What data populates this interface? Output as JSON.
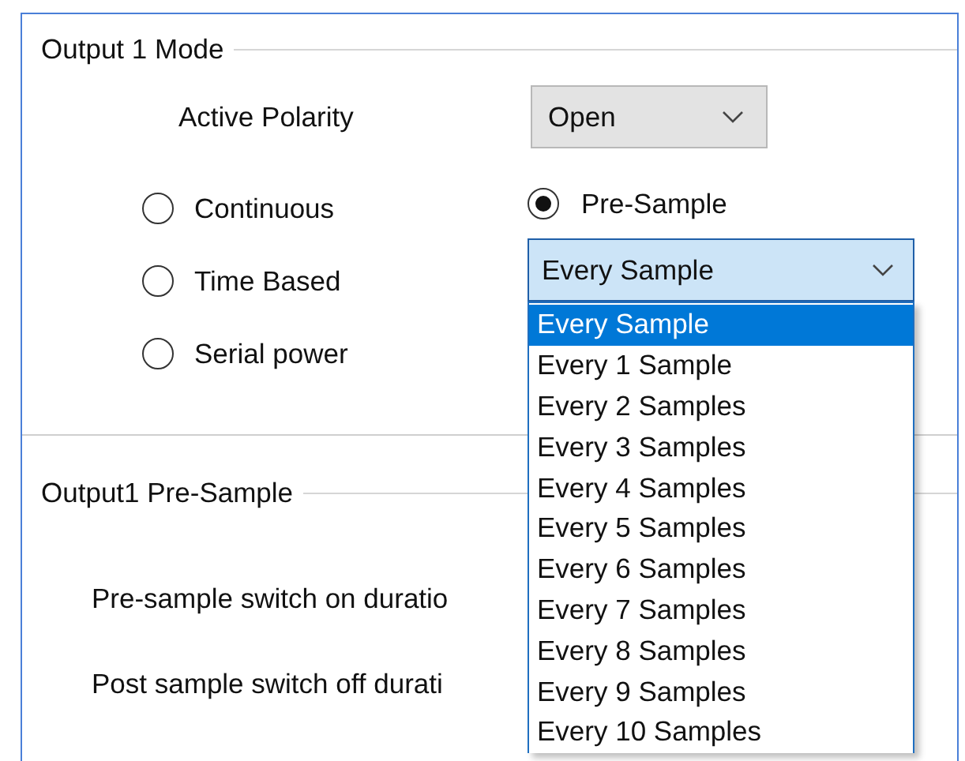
{
  "output_mode": {
    "title": "Output 1 Mode",
    "active_polarity": {
      "label": "Active Polarity",
      "value": "Open"
    },
    "modes": [
      {
        "label": "Continuous",
        "selected": false
      },
      {
        "label": "Time Based",
        "selected": false
      },
      {
        "label": "Serial power",
        "selected": false
      }
    ],
    "pre_sample": {
      "label": "Pre-Sample",
      "selected": true,
      "value": "Every Sample",
      "expanded": true,
      "options": [
        {
          "label": "Every Sample",
          "selected": true
        },
        {
          "label": "Every 1 Sample",
          "selected": false
        },
        {
          "label": "Every 2 Samples",
          "selected": false
        },
        {
          "label": "Every 3 Samples",
          "selected": false
        },
        {
          "label": "Every 4 Samples",
          "selected": false
        },
        {
          "label": "Every 5 Samples",
          "selected": false
        },
        {
          "label": "Every 6 Samples",
          "selected": false
        },
        {
          "label": "Every 7 Samples",
          "selected": false
        },
        {
          "label": "Every 8 Samples",
          "selected": false
        },
        {
          "label": "Every 9 Samples",
          "selected": false
        },
        {
          "label": "Every 10 Samples",
          "selected": false
        }
      ]
    }
  },
  "pre_sample_settings": {
    "title": "Output1 Pre-Sample",
    "fields": [
      {
        "label": "Pre-sample switch on duratio"
      },
      {
        "label": "Post sample switch off durati"
      }
    ]
  }
}
